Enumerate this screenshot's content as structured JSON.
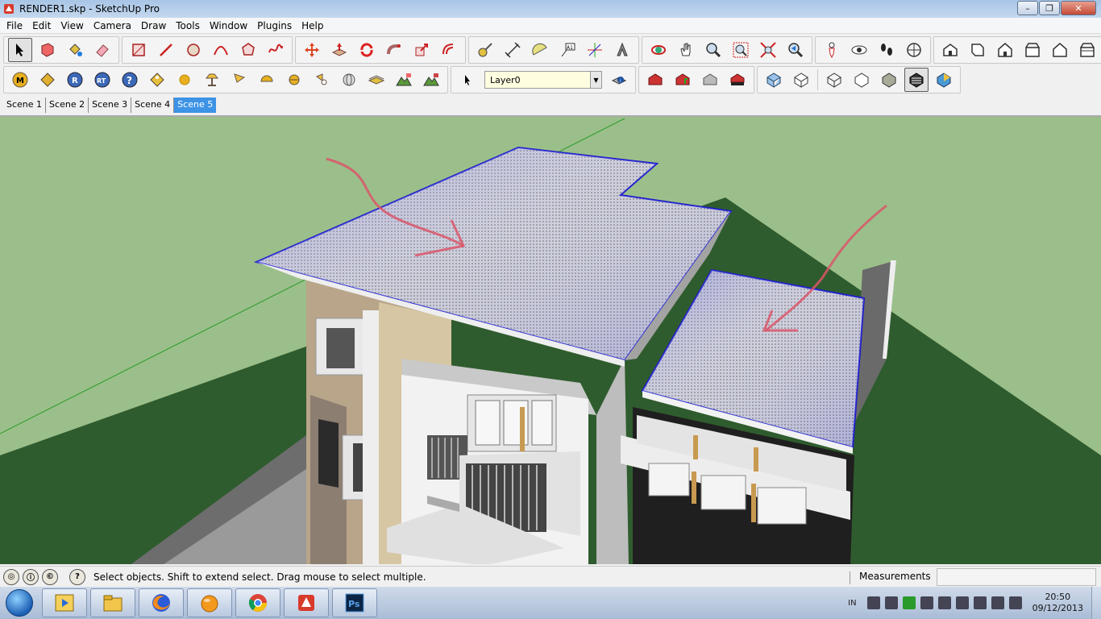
{
  "window": {
    "title": "RENDER1.skp - SketchUp Pro",
    "minimize": "–",
    "restore": "❐",
    "close": "✕"
  },
  "menu": [
    "File",
    "Edit",
    "View",
    "Camera",
    "Draw",
    "Tools",
    "Window",
    "Plugins",
    "Help"
  ],
  "toolbar1": {
    "tools": [
      "select-tool",
      "make-component-tool",
      "paint-bucket-tool",
      "eraser-tool",
      "rectangle-tool",
      "line-tool",
      "circle-tool",
      "arc-tool",
      "polygon-tool",
      "freehand-tool",
      "move-tool",
      "push-pull-tool",
      "rotate-tool",
      "follow-me-tool",
      "scale-tool",
      "offset-tool",
      "tape-measure-tool",
      "dimension-tool",
      "protractor-tool",
      "text-tool",
      "axes-tool",
      "3d-text-tool",
      "orbit-tool",
      "pan-tool",
      "zoom-tool",
      "zoom-window-tool",
      "zoom-extents-tool",
      "previous-view-tool",
      "position-camera-tool",
      "look-around-tool",
      "walk-tool",
      "section-plane-tool",
      "iso-view",
      "top-view",
      "front-view",
      "right-view",
      "back-view",
      "left-view"
    ]
  },
  "toolbar2": {
    "tools": [
      "m-icon",
      "tag-icon",
      "r-icon",
      "rt-icon",
      "help-icon",
      "label-icon",
      "sphere-icon",
      "lamp-icon",
      "flag-icon",
      "half-dome-icon",
      "dome-icon",
      "spotlight-icon",
      "globe-icon",
      "plane-icon",
      "landscape-icon",
      "landscape2-icon"
    ],
    "layer_value": "Layer0",
    "right_tools": [
      "layer-manager-icon",
      "warehouse-icon",
      "share-model-icon",
      "component-icon",
      "extension-icon",
      "xray-icon",
      "back-edges-icon",
      "wireframe-icon",
      "hidden-line-icon",
      "shaded-icon",
      "shaded-textures-icon",
      "monochrome-icon"
    ]
  },
  "scenes": [
    "Scene 1",
    "Scene 2",
    "Scene 3",
    "Scene 4",
    "Scene 5"
  ],
  "active_scene": "Scene 5",
  "status": {
    "message": "Select objects. Shift to extend select. Drag mouse to select multiple.",
    "measurements_label": "Measurements",
    "measurements_value": "",
    "icons": [
      "geo-location-icon",
      "credits-icon",
      "user-icon",
      "help-icon"
    ]
  },
  "taskbar": {
    "apps": [
      "media-player-icon",
      "file-explorer-icon",
      "firefox-icon",
      "orange-ball-icon",
      "chrome-icon",
      "sketchup-icon",
      "photoshop-icon"
    ],
    "lang": "IN",
    "time": "20:50",
    "date": "09/12/2013"
  },
  "colors": {
    "ground": "#2f5a2f",
    "sky": "#9bbf8a",
    "roof_select": "#1a1acc",
    "arrow": "#d9566a",
    "active_tab": "#3d93e6"
  }
}
